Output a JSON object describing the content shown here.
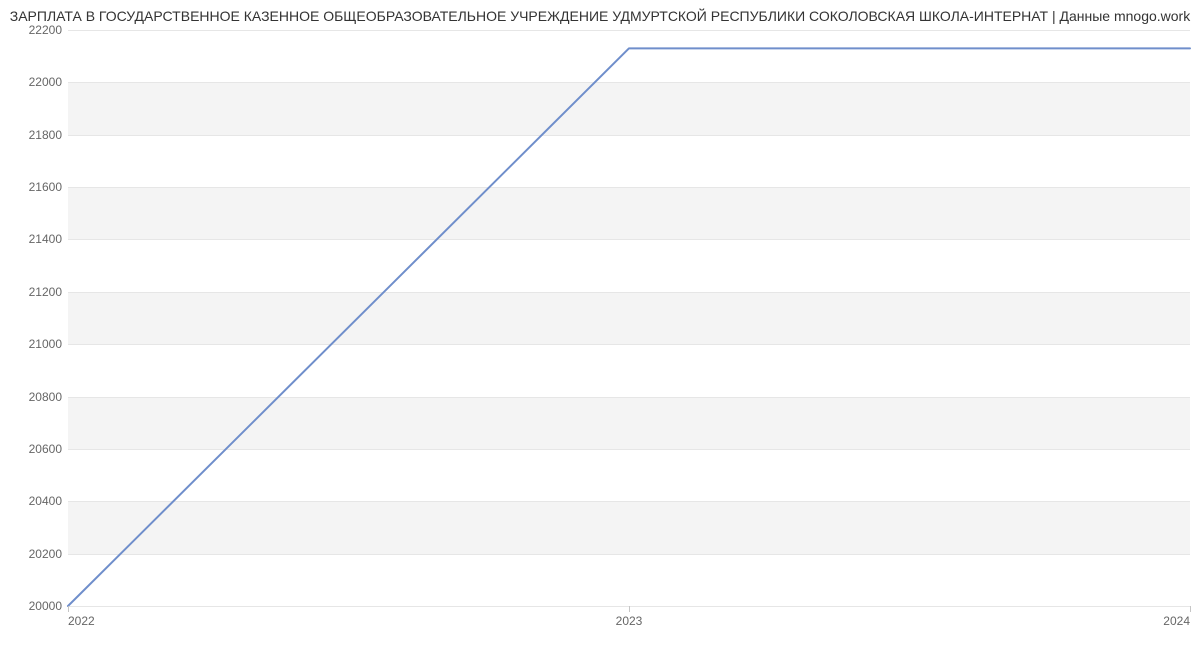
{
  "chart_data": {
    "type": "line",
    "title": "ЗАРПЛАТА В ГОСУДАРСТВЕННОЕ КАЗЕННОЕ ОБЩЕОБРАЗОВАТЕЛЬНОЕ УЧРЕЖДЕНИЕ УДМУРТСКОЙ РЕСПУБЛИКИ СОКОЛОВСКАЯ ШКОЛА-ИНТЕРНАТ | Данные mnogo.work",
    "x": [
      2022,
      2023,
      2024
    ],
    "values": [
      20000,
      22130,
      22130
    ],
    "xlabel": "",
    "ylabel": "",
    "x_ticks": [
      2022,
      2023,
      2024
    ],
    "y_ticks": [
      20000,
      20200,
      20400,
      20600,
      20800,
      21000,
      21200,
      21400,
      21600,
      21800,
      22000,
      22200
    ],
    "xlim": [
      2022,
      2024
    ],
    "ylim": [
      20000,
      22200
    ],
    "line_color": "#6f8ecb",
    "grid_band_color": "#f4f4f4"
  }
}
